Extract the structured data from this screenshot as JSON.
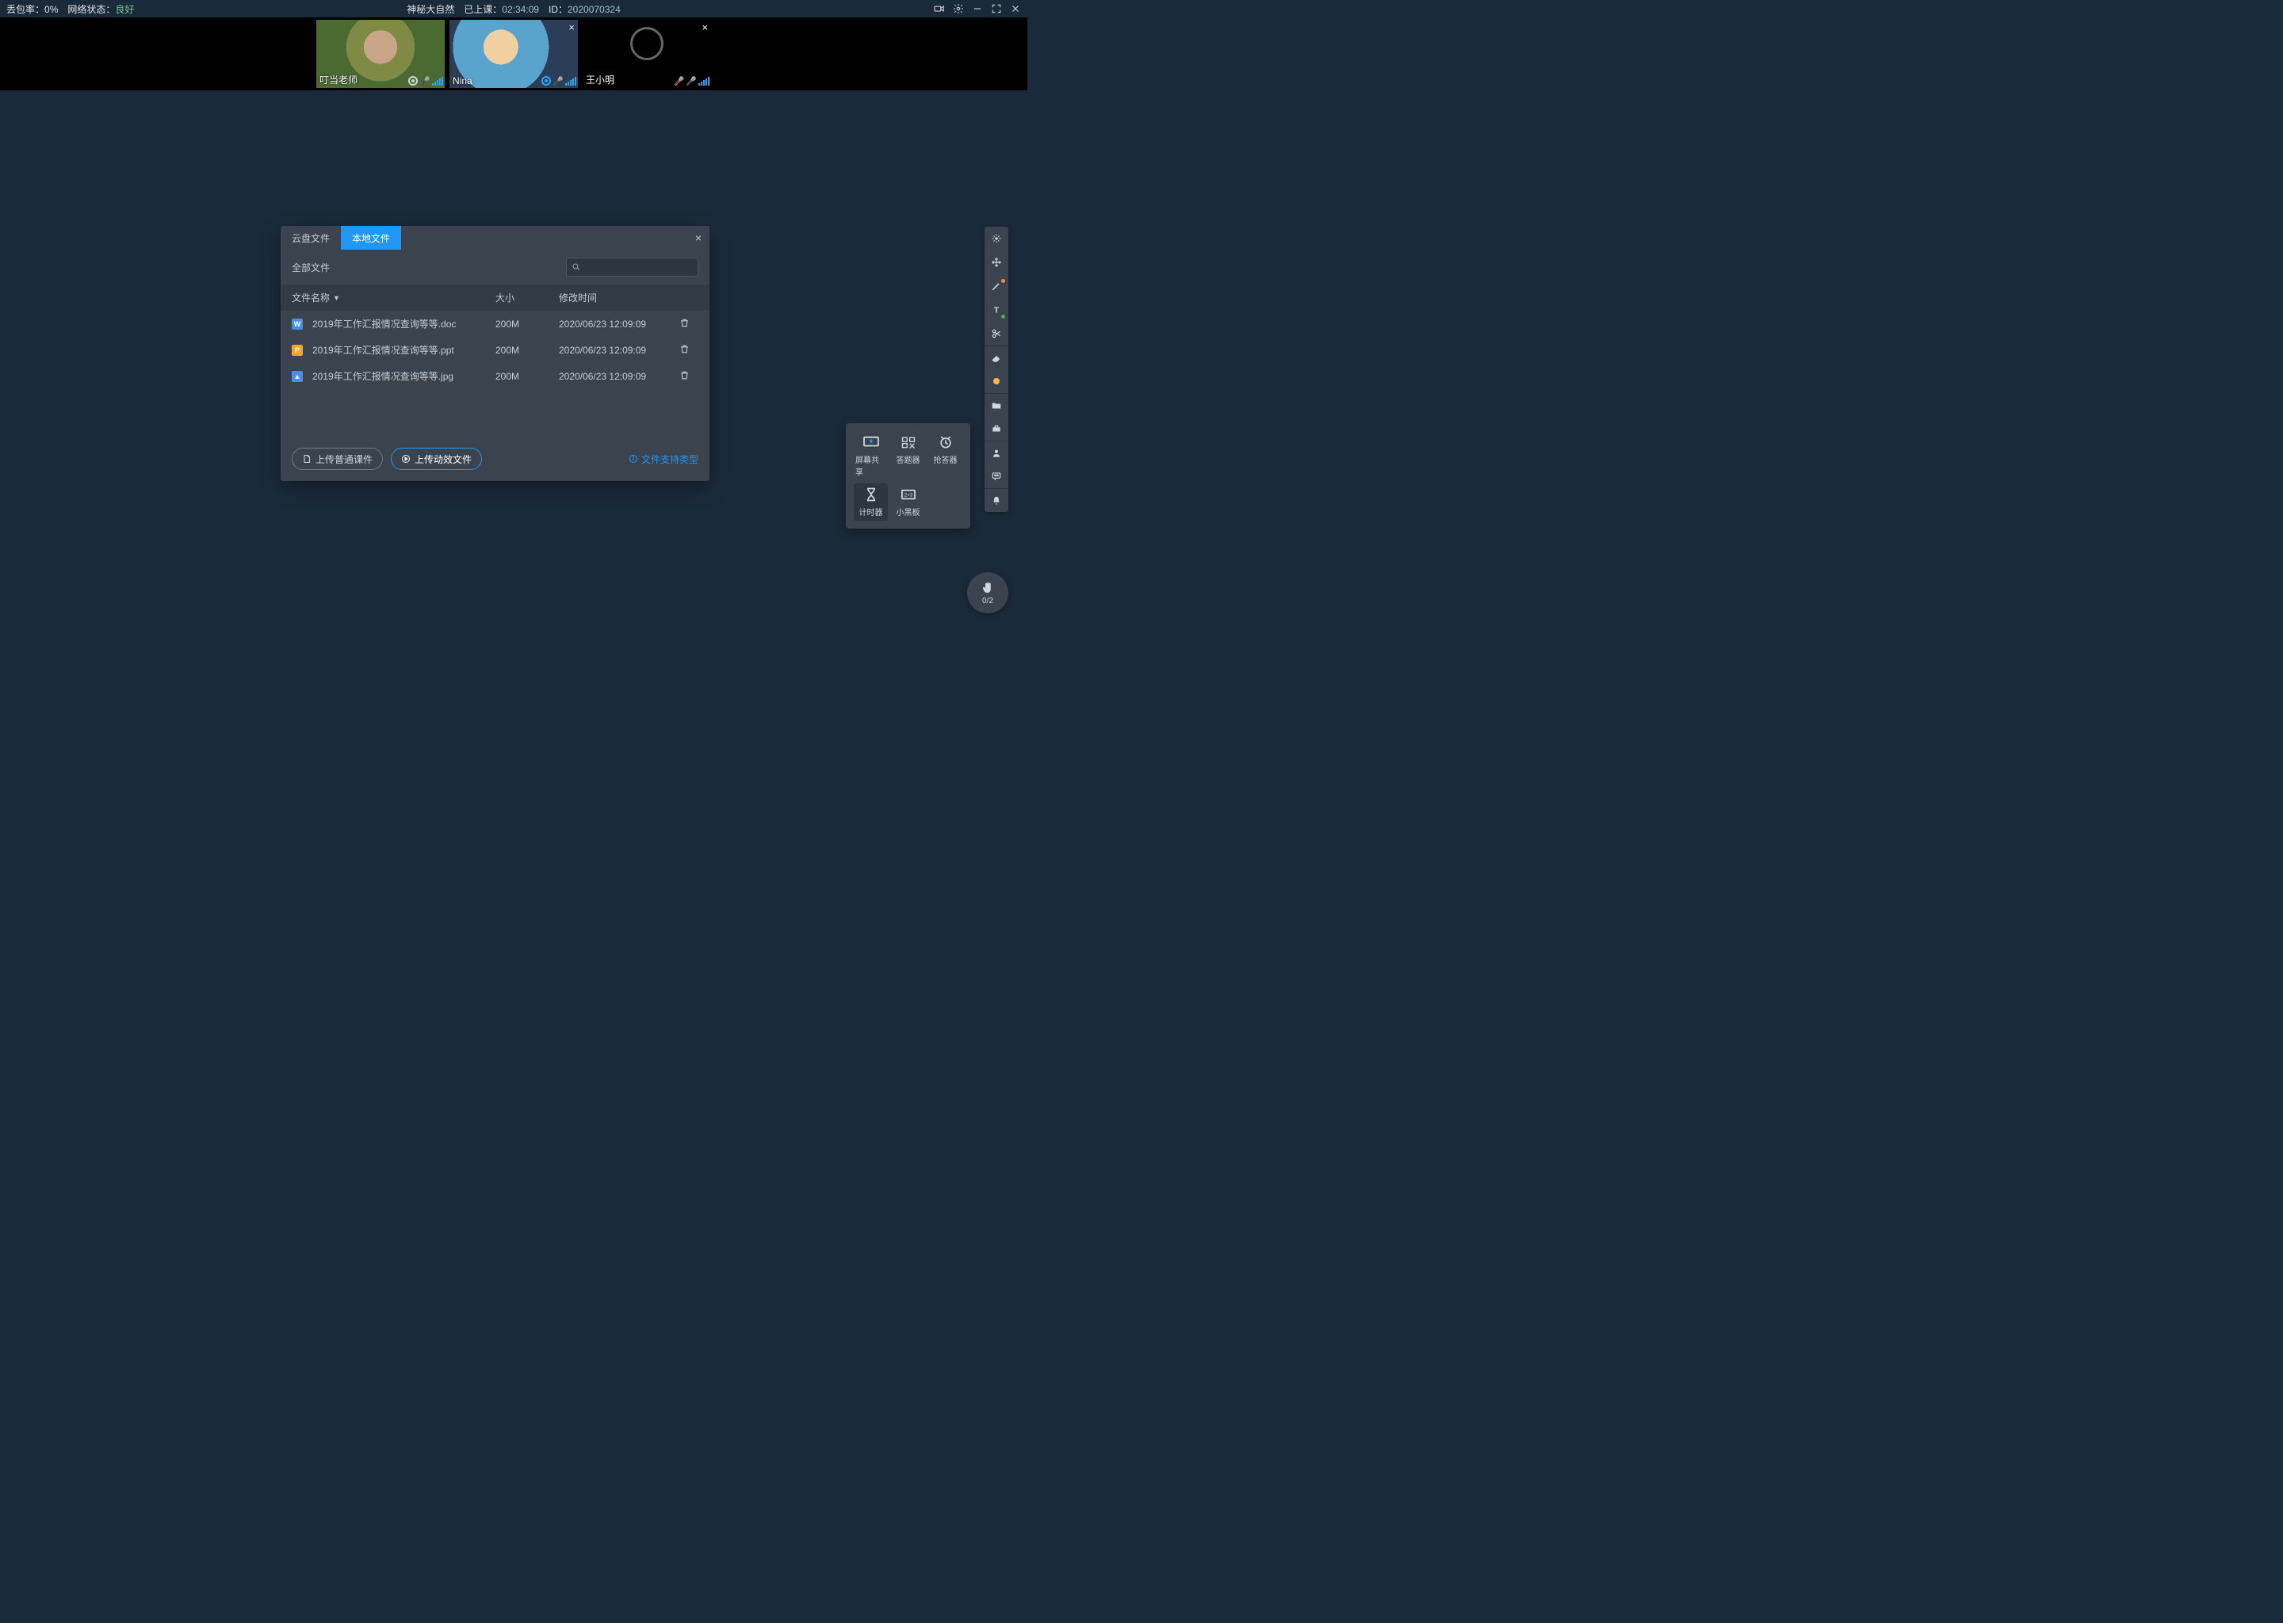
{
  "topbar": {
    "packet_loss_label": "丢包率：",
    "packet_loss_value": "0%",
    "network_label": "网络状态：",
    "network_value": "良好",
    "course_title": "神秘大自然",
    "elapsed_label": "已上课：",
    "elapsed_value": "02:34:09",
    "id_label": "ID：",
    "id_value": "2020070324"
  },
  "participants": [
    {
      "name": "叮当老师",
      "camera": true,
      "mic_on": true,
      "closeable": false,
      "signal": true,
      "recording": true
    },
    {
      "name": "Nina",
      "camera": true,
      "mic_on": true,
      "closeable": true,
      "signal": true,
      "recording_active": true
    },
    {
      "name": "王小明",
      "camera": false,
      "mic_on": false,
      "closeable": true,
      "signal": true,
      "mic_muted": true
    }
  ],
  "modal": {
    "tab_cloud": "云盘文件",
    "tab_local": "本地文件",
    "all_files": "全部文件",
    "columns": {
      "name": "文件名称",
      "size": "大小",
      "time": "修改时间"
    },
    "files": [
      {
        "icon": "W",
        "icon_type": "doc",
        "name": "2019年工作汇报情况查询等等.doc",
        "size": "200M",
        "time": "2020/06/23 12:09:09"
      },
      {
        "icon": "P",
        "icon_type": "ppt",
        "name": "2019年工作汇报情况查询等等.ppt",
        "size": "200M",
        "time": "2020/06/23 12:09:09"
      },
      {
        "icon": "▲",
        "icon_type": "jpg",
        "name": "2019年工作汇报情况查询等等.jpg",
        "size": "200M",
        "time": "2020/06/23 12:09:09"
      }
    ],
    "upload_normal": "上传普通课件",
    "upload_animated": "上传动效文件",
    "supported_types": "文件支持类型"
  },
  "toolpanel": {
    "screen_share": "屏幕共享",
    "answer": "答题器",
    "buzzer": "抢答器",
    "timer": "计时器",
    "blackboard": "小黑板"
  },
  "hand": {
    "count": "0/2"
  }
}
